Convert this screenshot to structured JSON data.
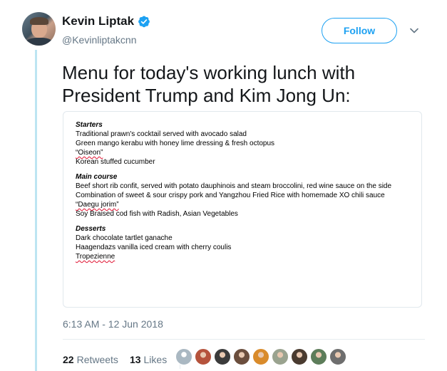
{
  "tweet": {
    "display_name": "Kevin Liptak",
    "handle": "@Kevinliptakcnn",
    "follow_label": "Follow",
    "text": "Menu for today's working lunch with President Trump and Kim Jong Un:",
    "timestamp": "6:13 AM - 12 Jun 2018",
    "retweets_count": "22",
    "retweets_label": "Retweets",
    "likes_count": "13",
    "likes_label": "Likes"
  },
  "menu": {
    "starters_heading": "Starters",
    "starters": [
      "Traditional prawn's cocktail served with avocado salad",
      "Green mango kerabu with honey lime dressing & fresh octopus",
      "“Oiseon”",
      "Korean stuffed cucumber"
    ],
    "main_heading": "Main course",
    "main": [
      "Beef short rib confit, served with potato dauphinois and steam broccolini, red wine sauce on the side",
      "Combination of sweet & sour crispy pork and Yangzhou Fried Rice with homemade XO chili sauce",
      "“Daegu jorim”",
      "Soy Braised cod fish with Radish, Asian Vegetables"
    ],
    "desserts_heading": "Desserts",
    "desserts": [
      "Dark chocolate tartlet ganache",
      "Haagendazs vanilla iced cream with cherry coulis",
      "Tropezienne"
    ]
  },
  "likers": [
    {
      "icon": "default-avatar",
      "color": "#aab8c2"
    },
    {
      "icon": "group-avatar",
      "color": "#b5533c"
    },
    {
      "icon": "person-avatar",
      "color": "#3b3b3b"
    },
    {
      "icon": "person-avatar",
      "color": "#6b4e3d"
    },
    {
      "icon": "cartoon-avatar",
      "color": "#d98b2b"
    },
    {
      "icon": "person-avatar",
      "color": "#9aa38f"
    },
    {
      "icon": "person-avatar",
      "color": "#4a3b30"
    },
    {
      "icon": "landscape-avatar",
      "color": "#5d7d5a"
    },
    {
      "icon": "person-avatar",
      "color": "#6e6e6e"
    }
  ],
  "colors": {
    "accent": "#1da1f2",
    "thread_line": "#bde5f2",
    "muted_text": "#657786"
  }
}
